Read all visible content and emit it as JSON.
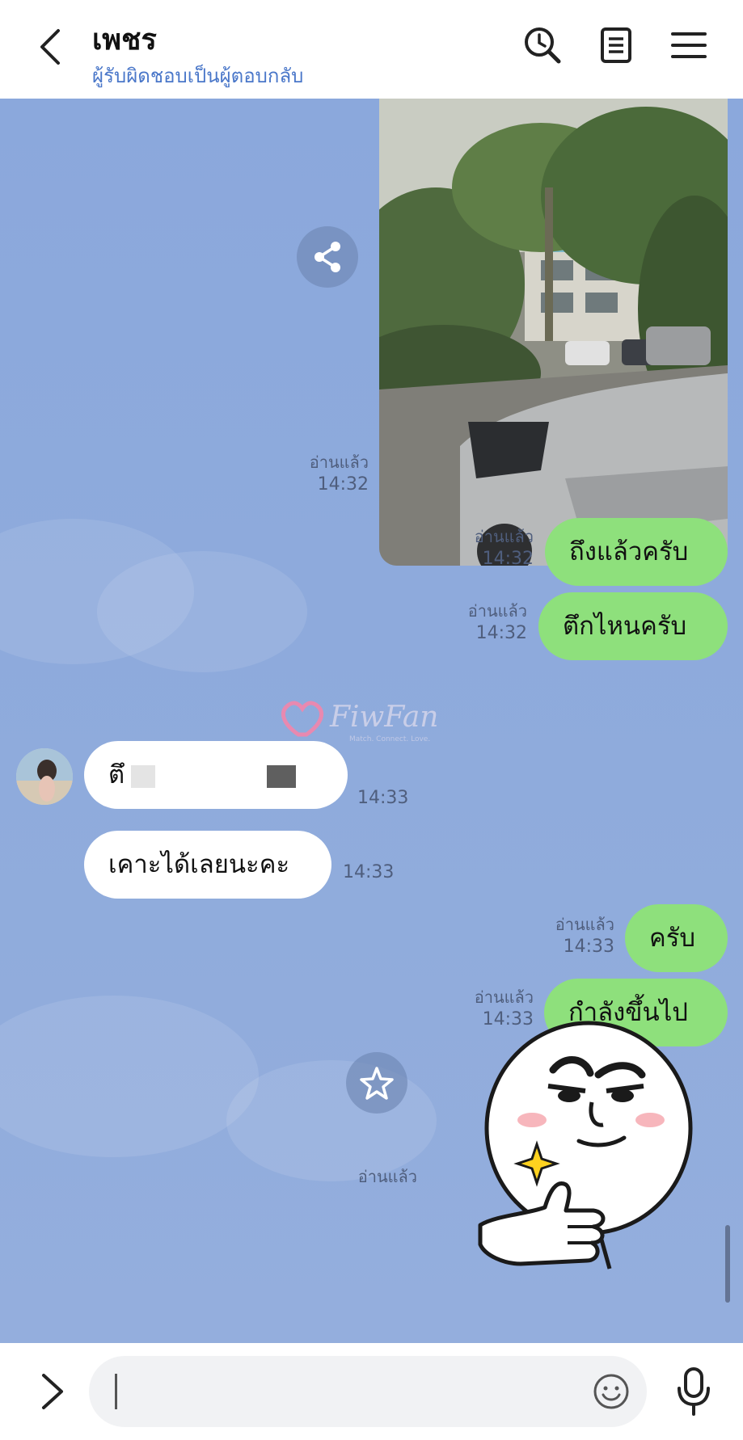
{
  "header": {
    "title": "เพชร",
    "subtitle": "ผู้รับผิดชอบเป็นผู้ตอบกลับ",
    "back_icon": "chevron-left-icon",
    "icons": [
      "history-search-icon",
      "notes-icon",
      "menu-icon"
    ]
  },
  "messages": {
    "photo": {
      "read": "อ่านแล้ว",
      "time": "14:32",
      "share_icon": "share-icon"
    },
    "m1": {
      "text": "ถึงแล้วครับ",
      "read": "อ่านแล้ว",
      "time": "14:32"
    },
    "m2": {
      "text": "ตึกไหนครับ",
      "read": "อ่านแล้ว",
      "time": "14:32"
    },
    "m3": {
      "text": "ตึ",
      "time": "14:33"
    },
    "m4": {
      "text": "เคาะได้เลยนะคะ",
      "time": "14:33"
    },
    "m5": {
      "text": "ครับ",
      "read": "อ่านแล้ว",
      "time": "14:33"
    },
    "m6": {
      "text": "กำลังขึ้นไป",
      "read": "อ่านแล้ว",
      "time": "14:33"
    },
    "sticker": {
      "read": "อ่านแล้ว",
      "star_icon": "star-icon"
    }
  },
  "watermark": {
    "brand": "FiwFan",
    "tagline": "Match. Connect. Love."
  },
  "input": {
    "placeholder": "",
    "emoji_icon": "emoji-icon",
    "mic_icon": "microphone-icon",
    "expand_icon": "chevron-right-icon"
  },
  "colors": {
    "chat_bg": "#8eaadc",
    "outgoing_bubble": "#8ee07c",
    "incoming_bubble": "#ffffff",
    "subtitle": "#4a77c9"
  }
}
